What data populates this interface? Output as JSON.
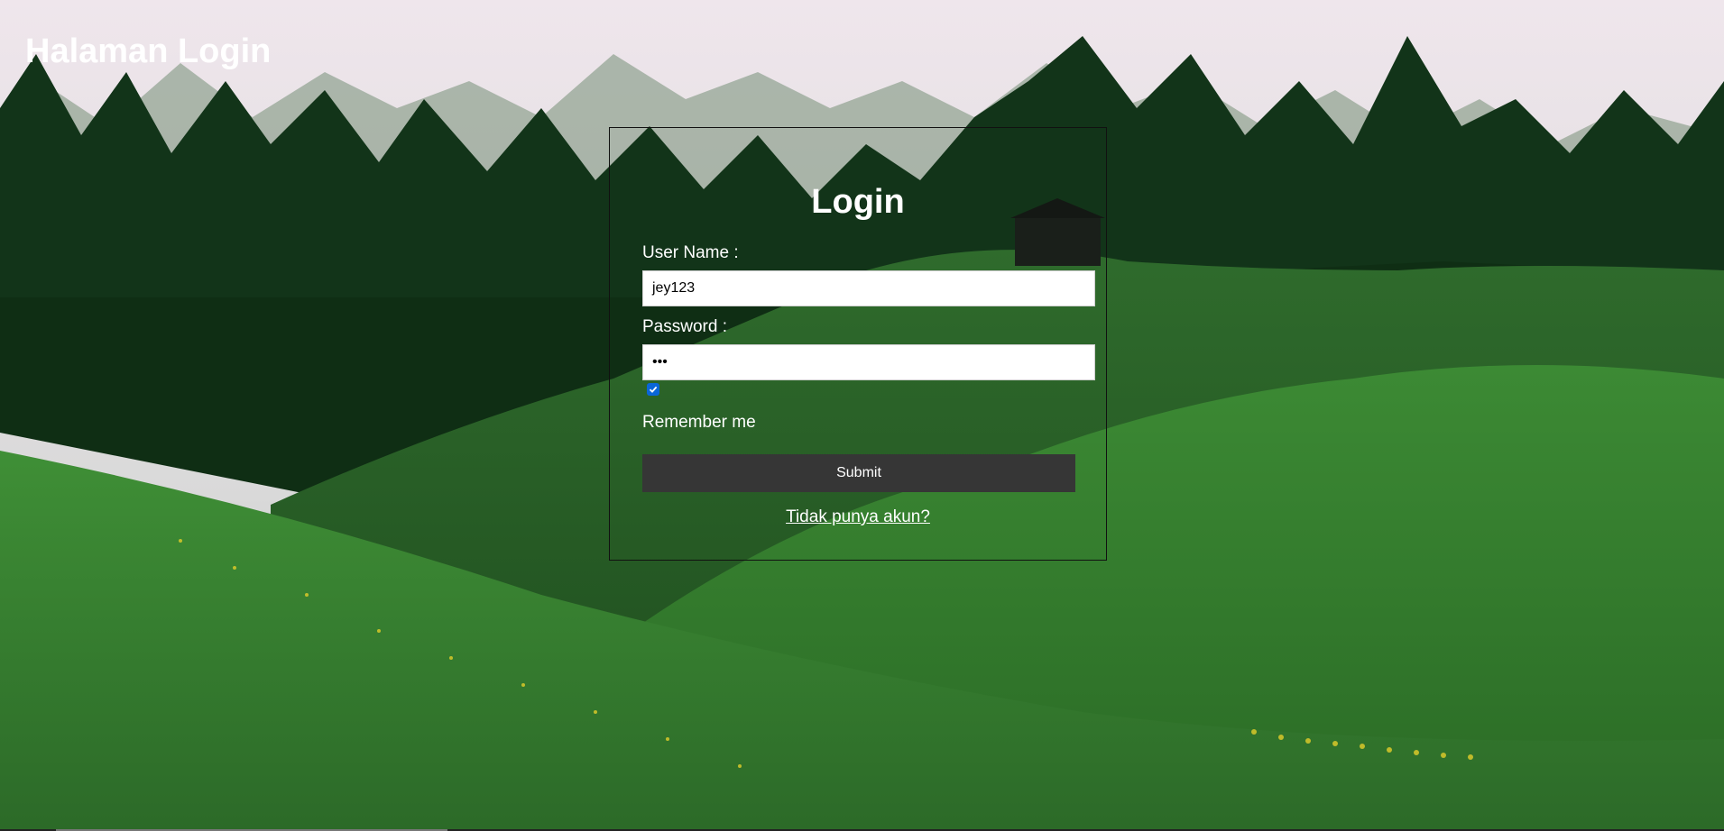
{
  "header": {
    "title": "Halaman Login"
  },
  "login": {
    "heading": "Login",
    "username_label": "User Name :",
    "username_value": "jey123",
    "password_label": "Password :",
    "password_value": "•••",
    "remember_checked": true,
    "remember_label": "Remember me",
    "submit_label": "Submit",
    "register_link": "Tidak punya akun?"
  },
  "colors": {
    "submit_bg": "#363636",
    "checkbox_accent": "#0a66d8",
    "text": "#ffffff"
  }
}
